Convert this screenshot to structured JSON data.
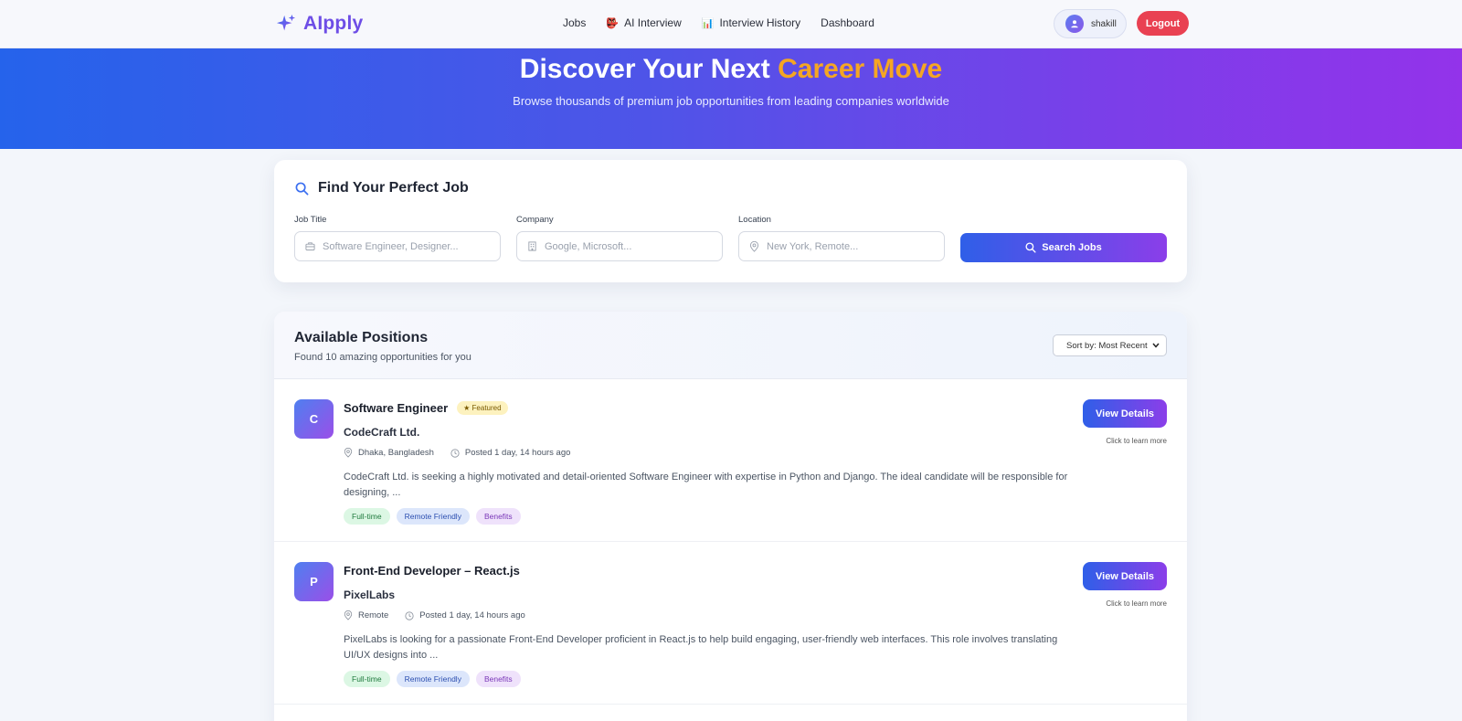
{
  "nav": {
    "brand": "AIpply",
    "links": [
      {
        "label": "Jobs",
        "emoji": ""
      },
      {
        "label": "AI Interview",
        "emoji": "👺"
      },
      {
        "label": "Interview History",
        "emoji": "📊"
      },
      {
        "label": "Dashboard",
        "emoji": ""
      }
    ],
    "username": "shakill",
    "logout_label": "Logout"
  },
  "hero": {
    "title_prefix": "Discover Your Next",
    "title_accent": "Career Move",
    "subtitle": "Browse thousands of premium job opportunities from leading companies worldwide"
  },
  "search": {
    "heading": "Find Your Perfect Job",
    "job_title_label": "Job Title",
    "job_title_placeholder": "Software Engineer, Designer...",
    "company_label": "Company",
    "company_placeholder": "Google, Microsoft...",
    "location_label": "Location",
    "location_placeholder": "New York, Remote...",
    "button_label": "Search Jobs"
  },
  "positions": {
    "title": "Available Positions",
    "subtitle": "Found 10 amazing opportunities for you",
    "sort_label": "Sort by: Most Recent",
    "jobs": [
      {
        "initial": "C",
        "title": "Software Engineer",
        "badge": "★ Featured",
        "company": "CodeCraft Ltd.",
        "location": "Dhaka, Bangladesh",
        "posted": "Posted 1 day, 14 hours ago",
        "description": "CodeCraft Ltd. is seeking a highly motivated and detail-oriented Software Engineer with expertise in Python and Django. The ideal candidate will be responsible for designing, ...",
        "tags": [
          "Full-time",
          "Remote Friendly",
          "Benefits"
        ],
        "button": "View Details",
        "hint": "Click to learn more"
      },
      {
        "initial": "P",
        "title": "Front-End Developer – React.js",
        "badge": "",
        "company": "PixelLabs",
        "location": "Remote",
        "posted": "Posted 1 day, 14 hours ago",
        "description": "PixelLabs is looking for a passionate Front-End Developer proficient in React.js to help build engaging, user-friendly web interfaces. This role involves translating UI/UX designs into ...",
        "tags": [
          "Full-time",
          "Remote Friendly",
          "Benefits"
        ],
        "button": "View Details",
        "hint": "Click to learn more"
      }
    ]
  },
  "colors": {
    "brand": "#6d4de6",
    "accent": "#f5a623",
    "logout": "#e94152",
    "gradient_start": "#2563eb",
    "gradient_end": "#9333ea"
  }
}
